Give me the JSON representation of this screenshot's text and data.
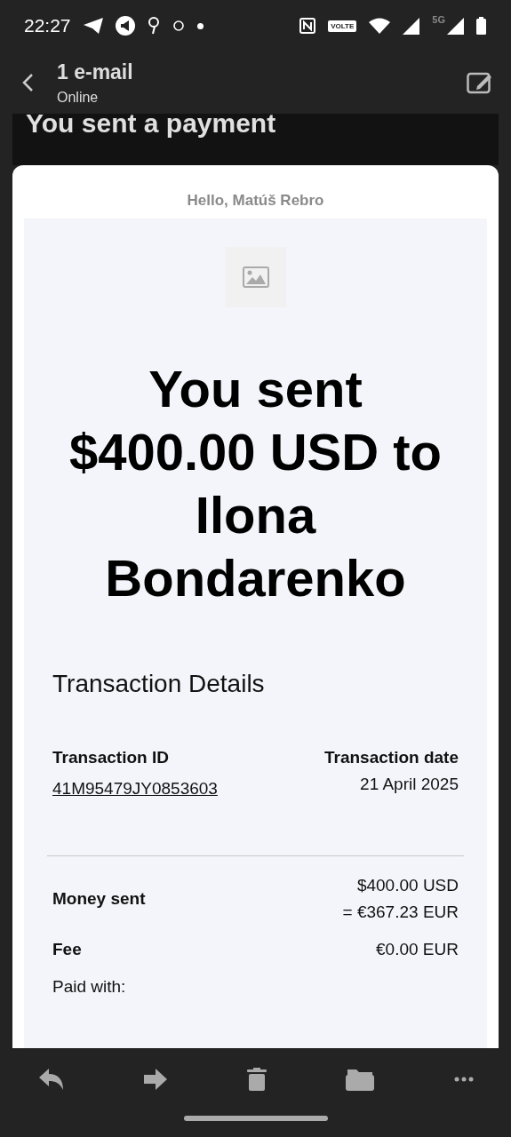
{
  "status_bar": {
    "time": "22:27",
    "volte": "VOLTE",
    "network": "5G"
  },
  "header": {
    "title": "1 e-mail",
    "subtitle": "Online"
  },
  "subject": "You sent a payment",
  "email": {
    "greeting": "Hello, Matúš Rebro",
    "headline": "You sent $400.00 USD to Ilona Bondarenko",
    "section_title": "Transaction Details",
    "transaction_id": {
      "label": "Transaction ID",
      "value": "41M95479JY0853603"
    },
    "transaction_date": {
      "label": "Transaction date",
      "value": "21 April 2025"
    },
    "rows": [
      {
        "label": "Money sent",
        "values": [
          "$400.00 USD",
          "= €367.23 EUR"
        ]
      },
      {
        "label": "Fee",
        "values": [
          "€0.00 EUR"
        ]
      }
    ],
    "paid_with": "Paid with:"
  }
}
